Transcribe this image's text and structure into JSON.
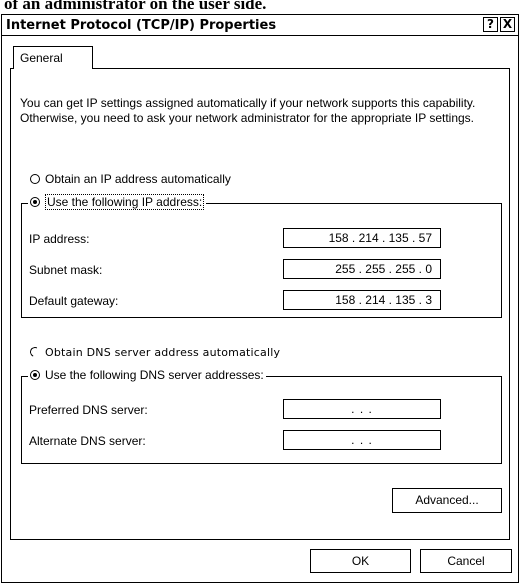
{
  "caption": "of an administrator on the user side.",
  "window": {
    "title": "Internet Protocol (TCP/IP) Properties",
    "help_button": "?",
    "close_button": "X"
  },
  "tabs": [
    {
      "label": "General",
      "selected": true
    }
  ],
  "description": "You can get IP settings assigned automatically if your network supports this capability. Otherwise, you need to ask your network administrator for the appropriate IP settings.",
  "ip_mode": {
    "auto_label": "Obtain an IP address automatically",
    "manual_label": "Use the following IP address:",
    "selected": "manual"
  },
  "ip_fields": [
    {
      "label": "IP address:",
      "value": "158 . 214 . 135 .  57"
    },
    {
      "label": "Subnet mask:",
      "value": "255 . 255 . 255 .   0"
    },
    {
      "label": "Default gateway:",
      "value": "158 . 214 . 135 .   3"
    }
  ],
  "dns_mode": {
    "auto_label": "Obtain DNS server address automatically",
    "manual_label": "Use the following DNS server addresses:",
    "selected": "manual"
  },
  "dns_fields": [
    {
      "label": "Preferred DNS server:",
      "value": ".       .       ."
    },
    {
      "label": "Alternate DNS server:",
      "value": ".       .       ."
    }
  ],
  "buttons": {
    "advanced": "Advanced...",
    "ok": "OK",
    "cancel": "Cancel"
  }
}
